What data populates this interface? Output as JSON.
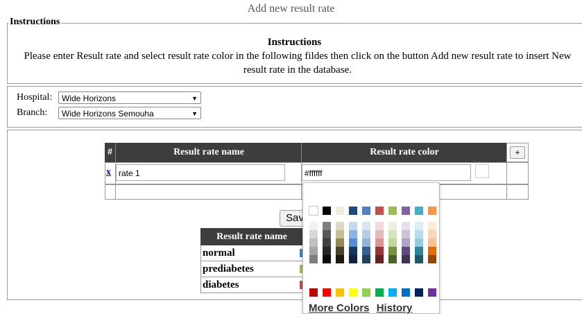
{
  "page": {
    "title": "Add new result rate"
  },
  "instructions": {
    "legend": "Instructions",
    "heading": "Instructions",
    "text": "Please enter Result rate and select result rate color in the following fildes then click on the button Add new result rate to insert New result rate in the database."
  },
  "filters": {
    "hospital_label": "Hospital:",
    "hospital_value": "Wide Horizons",
    "branch_label": "Branch:",
    "branch_value": "Wide Horizons Semouha"
  },
  "entry_table": {
    "col_index": "#",
    "col_name": "Result rate name",
    "col_color": "Result rate color",
    "add_row_label": "+",
    "rows": [
      {
        "delete_label": "x",
        "name": "rate 1",
        "color": "#ffffff"
      }
    ]
  },
  "save_button": {
    "label": "Save"
  },
  "rates_table": {
    "header": "Result rate name",
    "rows": [
      {
        "name": "normal",
        "color": "#4a7fc1"
      },
      {
        "name": "prediabetes",
        "color": "#9bbb59"
      },
      {
        "name": "diabetes",
        "color": "#c0504d"
      }
    ]
  },
  "color_picker": {
    "more_colors_label": "More Colors",
    "history_label": "History",
    "top_row": [
      "#ffffff",
      "#000000",
      "#eeece1",
      "#1f497d",
      "#4f81bd",
      "#c0504d",
      "#9bbb59",
      "#8064a2",
      "#4bacc6",
      "#f79646"
    ],
    "shade_columns": [
      [
        "#f2f2f2",
        "#d8d8d8",
        "#bfbfbf",
        "#a5a5a5",
        "#7f7f7f"
      ],
      [
        "#7f7f7f",
        "#595959",
        "#3f3f3f",
        "#262626",
        "#0c0c0c"
      ],
      [
        "#ddd9c3",
        "#c4bd97",
        "#938953",
        "#494429",
        "#1d1b10"
      ],
      [
        "#c6d9f0",
        "#8db3e2",
        "#548dd4",
        "#17365d",
        "#0f243e"
      ],
      [
        "#dbe5f1",
        "#b8cce4",
        "#95b3d7",
        "#366092",
        "#244061"
      ],
      [
        "#f2dcdb",
        "#e5b9b7",
        "#d99694",
        "#953734",
        "#632423"
      ],
      [
        "#ebf1dd",
        "#d7e3bc",
        "#c3d69b",
        "#76923c",
        "#4f6128"
      ],
      [
        "#e5e0ec",
        "#ccc1d9",
        "#b2a2c7",
        "#5f497a",
        "#3f3151"
      ],
      [
        "#dbeef3",
        "#b7dde8",
        "#92cddc",
        "#31859b",
        "#205867"
      ],
      [
        "#fdeada",
        "#fbd5b5",
        "#fac08f",
        "#e36c09",
        "#974806"
      ]
    ],
    "standard_row": [
      "#c00000",
      "#ff0000",
      "#ffc000",
      "#ffff00",
      "#92d050",
      "#00b050",
      "#00b0f0",
      "#0070c0",
      "#002060",
      "#7030a0"
    ]
  }
}
